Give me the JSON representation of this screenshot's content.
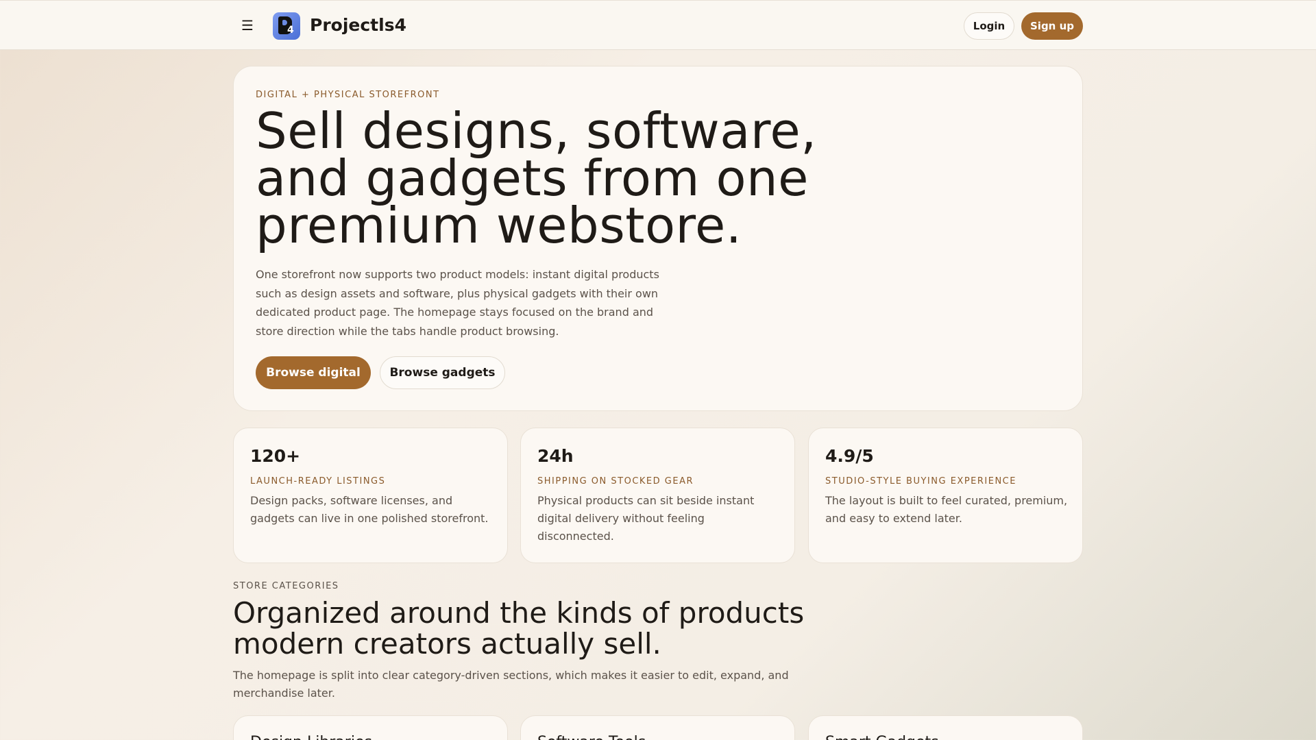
{
  "header": {
    "menu_icon": "menu-icon",
    "menu_glyph": "☰",
    "logo_icon": "logo-icon",
    "brand": "Projectls4",
    "login_label": "Login",
    "signup_label": "Sign up"
  },
  "hero": {
    "eyebrow": "DIGITAL + PHYSICAL STOREFRONT",
    "title": "Sell designs, software, and gadgets from one premium webstore.",
    "description": "One storefront now supports two product models: instant digital products such as design assets and software, plus physical gadgets with their own dedicated product page. The homepage stays focused on the brand and store direction while the tabs handle product browsing.",
    "primary_cta": "Browse digital",
    "secondary_cta": "Browse gadgets"
  },
  "stats": [
    {
      "value": "120+",
      "label": "LAUNCH-READY LISTINGS",
      "text": "Design packs, software licenses, and gadgets can live in one polished storefront."
    },
    {
      "value": "24h",
      "label": "SHIPPING ON STOCKED GEAR",
      "text": "Physical products can sit beside instant digital delivery without feeling disconnected."
    },
    {
      "value": "4.9/5",
      "label": "STUDIO-STYLE BUYING EXPERIENCE",
      "text": "The layout is built to feel curated, premium, and easy to extend later."
    }
  ],
  "categories": {
    "eyebrow": "STORE CATEGORIES",
    "title": "Organized around the kinds of products modern creators actually sell.",
    "description": "The homepage is split into clear category-driven sections, which makes it easier to edit, expand, and merchandise later.",
    "cards": [
      {
        "title": "Design Libraries"
      },
      {
        "title": "Software Tools"
      },
      {
        "title": "Smart Gadgets"
      }
    ]
  },
  "colors": {
    "accent": "#a3692d",
    "eyebrow": "#8a5a2b",
    "card_bg": "#fcf8f3",
    "text": "#1f1b17",
    "muted": "#5b524a"
  }
}
